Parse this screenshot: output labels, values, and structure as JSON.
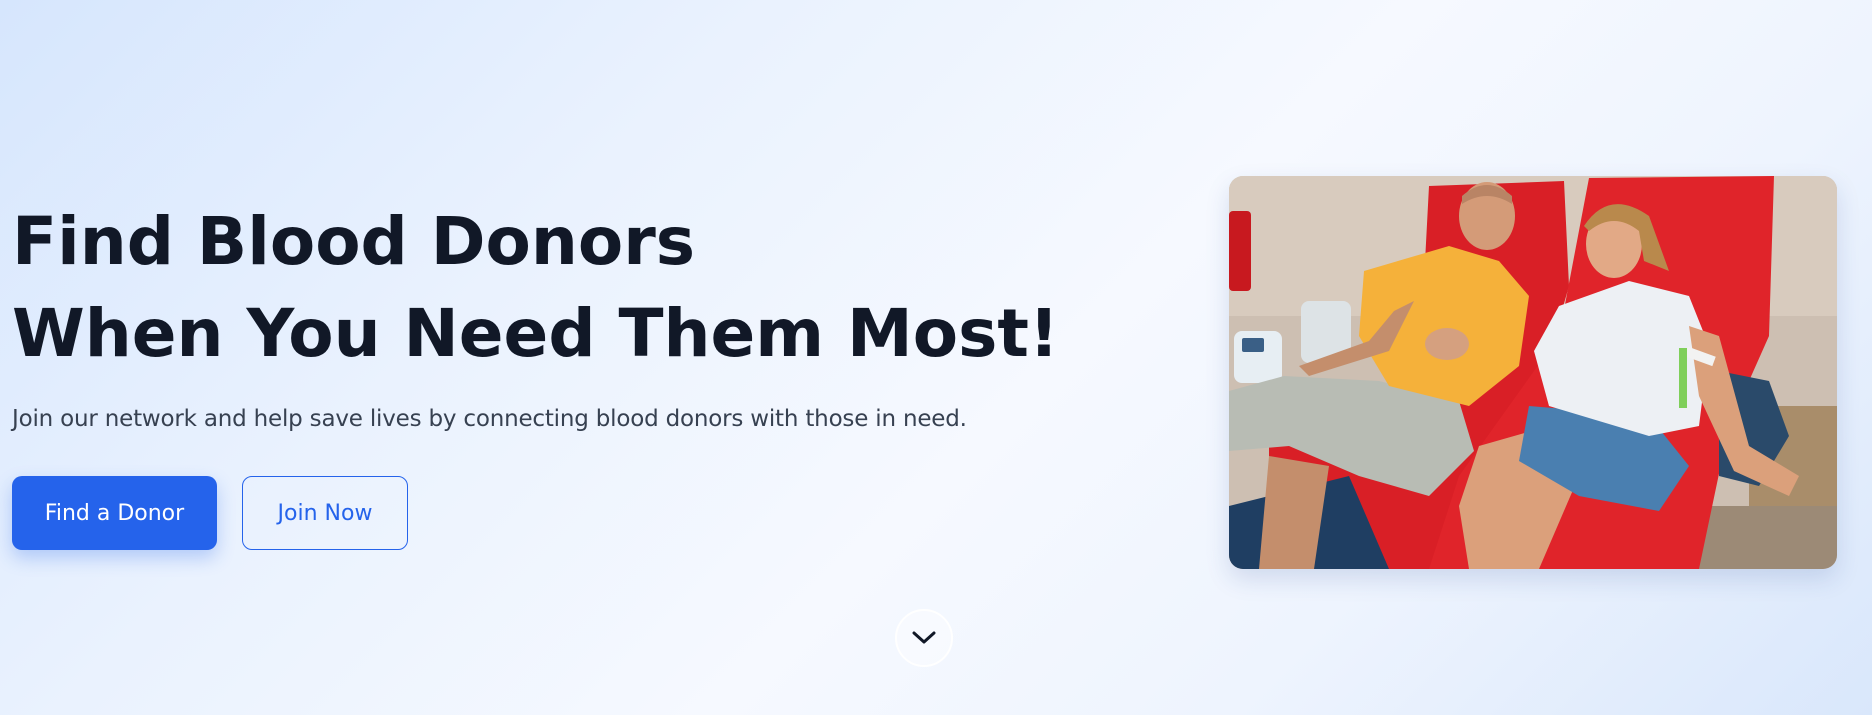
{
  "hero": {
    "headline_line1": "Find Blood Donors",
    "headline_line2": "When You Need Them Most!",
    "subtext": "Join our network and help save lives by connecting blood donors with those in need."
  },
  "actions": {
    "primary_label": "Find a Donor",
    "secondary_label": "Join Now"
  },
  "image": {
    "alt": "Two smiling blood donors holding hands in red donation chairs"
  },
  "scroll": {
    "icon": "chevron-down-icon"
  },
  "colors": {
    "accent": "#2563eb",
    "heading": "#111827",
    "body_text": "#374151",
    "chair_red": "#d91f26"
  }
}
